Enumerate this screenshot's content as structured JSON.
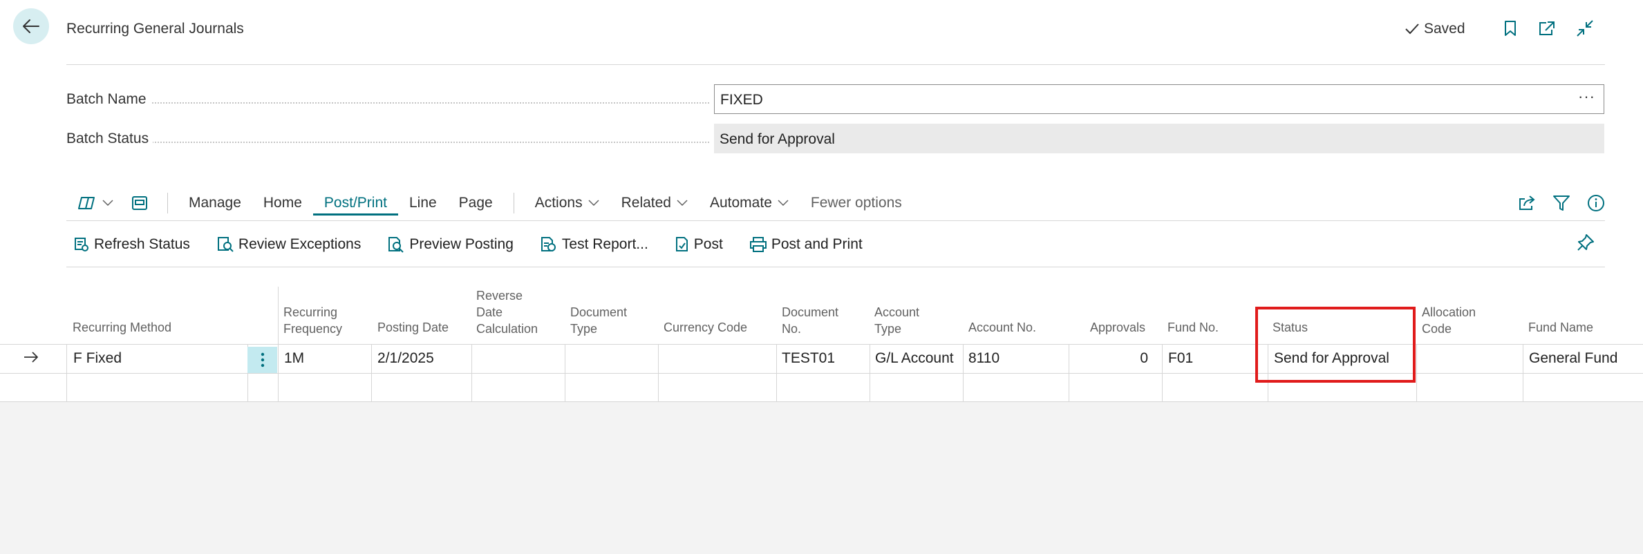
{
  "header": {
    "title": "Recurring General Journals",
    "saved_label": "Saved"
  },
  "fields": {
    "batch_name_label": "Batch Name",
    "batch_name_value": "FIXED",
    "batch_name_ellipsis": "···",
    "batch_status_label": "Batch Status",
    "batch_status_value": "Send for Approval"
  },
  "action_bar": {
    "tabs": [
      "Manage",
      "Home",
      "Post/Print",
      "Line",
      "Page"
    ],
    "active_tab": "Post/Print",
    "menus": [
      "Actions",
      "Related",
      "Automate"
    ],
    "fewer_options": "Fewer options"
  },
  "commands": [
    {
      "label": "Refresh Status",
      "icon": "refresh-status-icon"
    },
    {
      "label": "Review Exceptions",
      "icon": "review-exceptions-icon"
    },
    {
      "label": "Preview Posting",
      "icon": "preview-posting-icon"
    },
    {
      "label": "Test Report...",
      "icon": "test-report-icon"
    },
    {
      "label": "Post",
      "icon": "post-icon"
    },
    {
      "label": "Post and Print",
      "icon": "post-and-print-icon"
    }
  ],
  "grid": {
    "columns": [
      "Recurring Method",
      "Recurring Frequency",
      "Posting Date",
      "Reverse Date Calculation",
      "Document Type",
      "Currency Code",
      "Document No.",
      "Account Type",
      "Account No.",
      "Approvals",
      "Fund No.",
      "Status",
      "Allocation Code",
      "Fund Name"
    ],
    "rows": [
      {
        "recurring_method": "F Fixed",
        "recurring_frequency": "1M",
        "posting_date": "2/1/2025",
        "reverse_date_calculation": "",
        "document_type": "",
        "currency_code": "",
        "document_no": "TEST01",
        "account_type": "G/L Account",
        "account_no": "8110",
        "approvals": "0",
        "fund_no": "F01",
        "status": "Send for Approval",
        "allocation_code": "",
        "fund_name": "General Fund"
      }
    ]
  },
  "colors": {
    "accent": "#00707f",
    "highlight": "#e01b1b",
    "back_button_bg": "#d7eef1"
  }
}
